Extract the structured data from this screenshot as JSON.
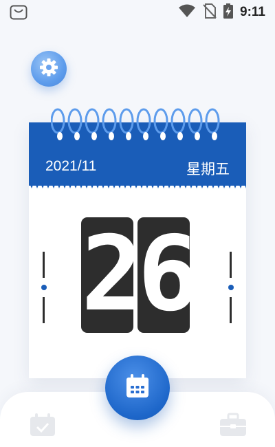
{
  "status_bar": {
    "time": "9:11",
    "icons": [
      "shopping-bag-icon",
      "wifi-icon",
      "no-sim-icon",
      "battery-charging-icon"
    ]
  },
  "settings": {
    "icon": "gear-icon"
  },
  "calendar": {
    "year_month": "2021/11",
    "weekday": "星期五",
    "day_digits": [
      "2",
      "6"
    ],
    "accent_color": "#1a5db8",
    "digit_color": "#2d2d2d"
  },
  "bottom_nav": {
    "left_icon": "calendar-check-icon",
    "center_icon": "calendar-icon",
    "right_icon": "toolbox-icon"
  }
}
